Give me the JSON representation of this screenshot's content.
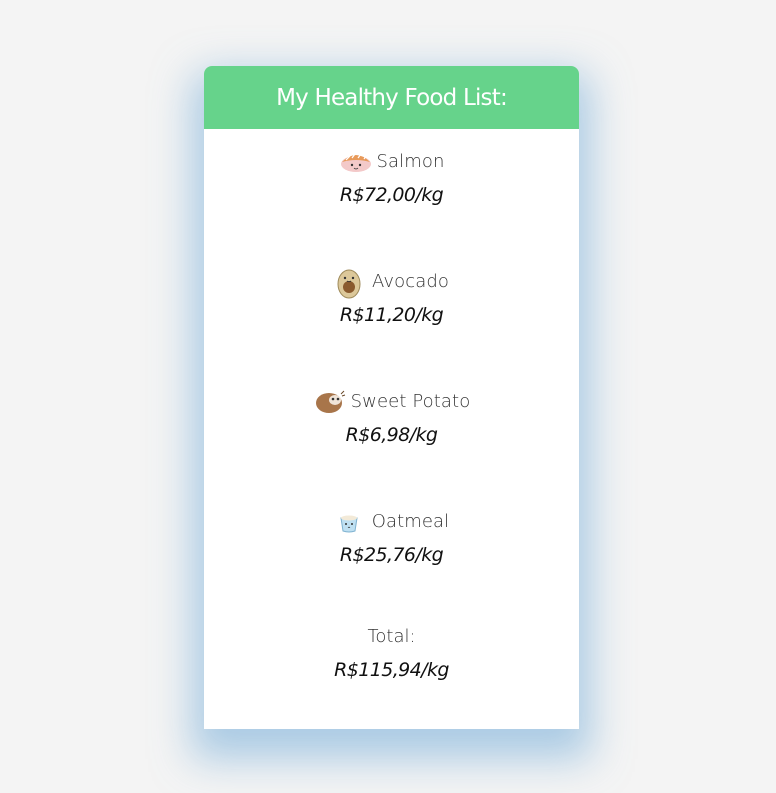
{
  "card": {
    "title": "My Healthy Food List:"
  },
  "items": [
    {
      "name": "Salmon",
      "price": "R$72,00/kg",
      "icon": "salmon-icon"
    },
    {
      "name": "Avocado",
      "price": "R$11,20/kg",
      "icon": "avocado-icon"
    },
    {
      "name": "Sweet Potato",
      "price": "R$6,98/kg",
      "icon": "sweet-potato-icon"
    },
    {
      "name": "Oatmeal",
      "price": "R$25,76/kg",
      "icon": "oatmeal-icon"
    }
  ],
  "total": {
    "label": "Total:",
    "value": "R$115,94/kg"
  },
  "colors": {
    "header": "#66d38b",
    "background": "#f4f4f4",
    "card": "#ffffff",
    "shadow": "#70aad7"
  }
}
